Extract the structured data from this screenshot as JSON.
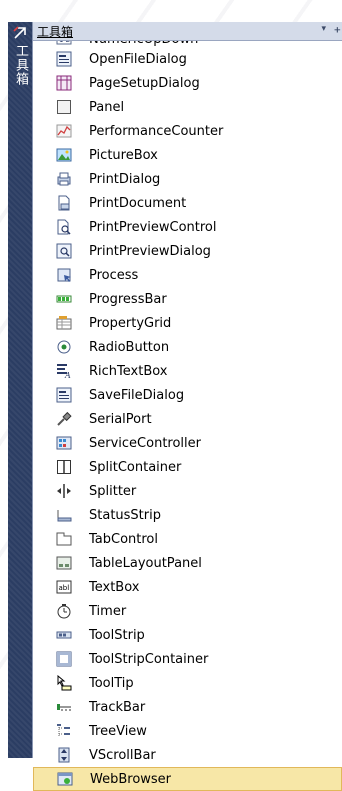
{
  "sidetab": {
    "label": "工具箱",
    "icon": "pin-icon"
  },
  "titlebar": {
    "title": "工具箱",
    "dropdown": "▾",
    "pin": "ᚐ"
  },
  "toolbox_items": [
    {
      "label": "NumericUpDown",
      "icon": "numeric-updown-icon"
    },
    {
      "label": "OpenFileDialog",
      "icon": "open-file-dialog-icon"
    },
    {
      "label": "PageSetupDialog",
      "icon": "page-setup-dialog-icon"
    },
    {
      "label": "Panel",
      "icon": "panel-icon"
    },
    {
      "label": "PerformanceCounter",
      "icon": "performance-counter-icon"
    },
    {
      "label": "PictureBox",
      "icon": "picturebox-icon"
    },
    {
      "label": "PrintDialog",
      "icon": "print-dialog-icon"
    },
    {
      "label": "PrintDocument",
      "icon": "print-document-icon"
    },
    {
      "label": "PrintPreviewControl",
      "icon": "print-preview-control-icon"
    },
    {
      "label": "PrintPreviewDialog",
      "icon": "print-preview-dialog-icon"
    },
    {
      "label": "Process",
      "icon": "process-icon"
    },
    {
      "label": "ProgressBar",
      "icon": "progressbar-icon"
    },
    {
      "label": "PropertyGrid",
      "icon": "property-grid-icon"
    },
    {
      "label": "RadioButton",
      "icon": "radio-button-icon"
    },
    {
      "label": "RichTextBox",
      "icon": "rich-textbox-icon"
    },
    {
      "label": "SaveFileDialog",
      "icon": "save-file-dialog-icon"
    },
    {
      "label": "SerialPort",
      "icon": "serial-port-icon"
    },
    {
      "label": "ServiceController",
      "icon": "service-controller-icon"
    },
    {
      "label": "SplitContainer",
      "icon": "split-container-icon"
    },
    {
      "label": "Splitter",
      "icon": "splitter-icon"
    },
    {
      "label": "StatusStrip",
      "icon": "status-strip-icon"
    },
    {
      "label": "TabControl",
      "icon": "tab-control-icon"
    },
    {
      "label": "TableLayoutPanel",
      "icon": "table-layout-panel-icon"
    },
    {
      "label": "TextBox",
      "icon": "textbox-icon"
    },
    {
      "label": "Timer",
      "icon": "timer-icon"
    },
    {
      "label": "ToolStrip",
      "icon": "toolstrip-icon"
    },
    {
      "label": "ToolStripContainer",
      "icon": "toolstrip-container-icon"
    },
    {
      "label": "ToolTip",
      "icon": "tooltip-icon"
    },
    {
      "label": "TrackBar",
      "icon": "trackbar-icon"
    },
    {
      "label": "TreeView",
      "icon": "treeview-icon"
    },
    {
      "label": "VScrollBar",
      "icon": "vscrollbar-icon"
    },
    {
      "label": "WebBrowser",
      "icon": "web-browser-icon"
    }
  ],
  "selected_item": "WebBrowser",
  "colors": {
    "sidetab": "#2b3d63",
    "titlebar": "#d4dbe9",
    "selection": "#f7e7a7",
    "selection_border": "#e1b85a"
  }
}
